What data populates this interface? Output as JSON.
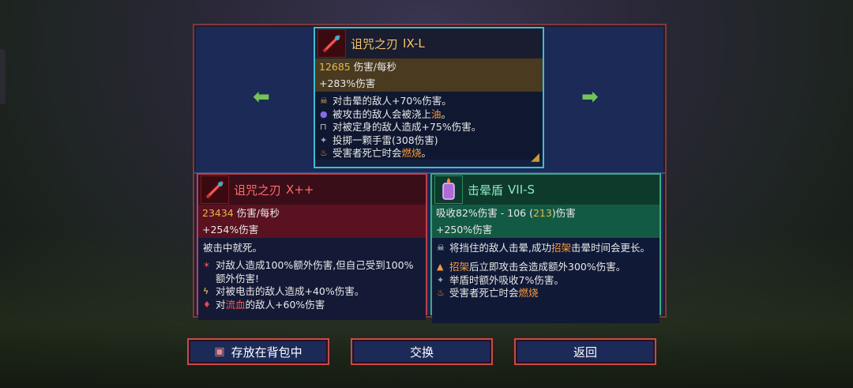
{
  "top_card": {
    "name": "诅咒之刃",
    "tier": "IX-L",
    "dps_value": "12685",
    "dps_label": "伤害/每秒",
    "bonus": "+283%伤害",
    "effects": [
      {
        "icon": "stun-skull-icon",
        "parts": [
          {
            "t": "对击晕的敌人+70%伤害。",
            "c": ""
          }
        ]
      },
      {
        "icon": "oil-orb-icon",
        "parts": [
          {
            "t": "被攻击的敌人会被浇上",
            "c": ""
          },
          {
            "t": "油",
            "c": "orange"
          },
          {
            "t": "。",
            "c": ""
          }
        ]
      },
      {
        "icon": "lock-icon",
        "parts": [
          {
            "t": "对被定身的敌人造成+75%伤害。",
            "c": ""
          }
        ]
      },
      {
        "icon": "sparkle-icon",
        "parts": [
          {
            "t": "投掷一颗手雷(308伤害)",
            "c": ""
          }
        ]
      },
      {
        "icon": "fire-icon",
        "parts": [
          {
            "t": "受害者死亡时会",
            "c": ""
          },
          {
            "t": "燃烧",
            "c": "orange"
          },
          {
            "t": "。",
            "c": ""
          }
        ]
      }
    ]
  },
  "left_card": {
    "name": "诅咒之刃",
    "tier": "X++",
    "dps_value": "23434",
    "dps_label": "伤害/每秒",
    "bonus": "+254%伤害",
    "plain": "被击中就死。",
    "effects": [
      {
        "icon": "curse-icon",
        "parts": [
          {
            "t": "对敌人造成100%额外伤害,但自己受到100%额外伤害!",
            "c": ""
          }
        ]
      },
      {
        "icon": "lightning-icon",
        "parts": [
          {
            "t": "对被电击的敌人造成+40%伤害。",
            "c": ""
          }
        ]
      },
      {
        "icon": "blood-icon",
        "parts": [
          {
            "t": "对",
            "c": ""
          },
          {
            "t": "流血",
            "c": "red"
          },
          {
            "t": "的敌人+60%伤害",
            "c": ""
          }
        ]
      }
    ]
  },
  "right_card": {
    "name": "击晕盾",
    "tier": "VII-S",
    "absorb": "吸收82%伤害 - 106 (",
    "absorb_hi": "213",
    "absorb_tail": ")伤害",
    "bonus": "+250%伤害",
    "top_effect": [
      {
        "t": "将挡住的敌人击晕,成功",
        "c": ""
      },
      {
        "t": "招架",
        "c": "orange"
      },
      {
        "t": "击晕时间会更长。",
        "c": ""
      }
    ],
    "effects": [
      {
        "icon": "parry-icon",
        "parts": [
          {
            "t": "招架",
            "c": "orange"
          },
          {
            "t": "后立即攻击会造成额外300%伤害。",
            "c": ""
          }
        ]
      },
      {
        "icon": "sparkle-icon",
        "parts": [
          {
            "t": "举盾时额外吸收7%伤害。",
            "c": ""
          }
        ]
      },
      {
        "icon": "fire-icon",
        "parts": [
          {
            "t": "受害者死亡时会",
            "c": ""
          },
          {
            "t": "燃烧",
            "c": "orange"
          }
        ]
      }
    ]
  },
  "buttons": {
    "store": "存放在背包中",
    "swap": "交换",
    "back": "返回"
  },
  "colors": {
    "panel_bg": "#1b2a56",
    "top_border": "#3dbed0",
    "left_border": "#c0404a",
    "right_border": "#3aaa86",
    "highlight": "#ff9a3a"
  }
}
